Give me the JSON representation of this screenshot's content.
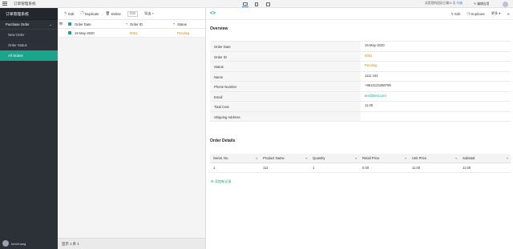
{
  "topbar": {
    "app_title": "订单管理系统",
    "trial_text": "试用您的团队已剩 6 天",
    "upgrade_label": "升级",
    "edit_app_label": "编辑应用"
  },
  "sidebar": {
    "brand": "订单管理系统",
    "group_label": "Purchase Order",
    "items": [
      {
        "label": "New Order"
      },
      {
        "label": "Order Status"
      },
      {
        "label": "All Orders"
      }
    ],
    "user_name": "kevinhang"
  },
  "list": {
    "toolbar": {
      "edit_label": "Edit",
      "duplicate_label": "Duplicate",
      "delete_label": "Delete",
      "print_label": "打印",
      "more_label": "导出"
    },
    "columns": [
      "Order Date",
      "Order ID",
      "Status"
    ],
    "rows": [
      {
        "date": "15-May-2020",
        "id": "0001",
        "status": "Pending"
      }
    ],
    "footer": "显示 1 条 1"
  },
  "detail": {
    "actions": {
      "edit_label": "Edit",
      "duplicate_label": "Duplicate",
      "more_label": "更多"
    },
    "overview_title": "Overview",
    "fields": [
      {
        "label": "Order Date",
        "value": "15-May-2020"
      },
      {
        "label": "Order ID",
        "value": "0001"
      },
      {
        "label": "Status",
        "value": "Pending"
      },
      {
        "label": "Name",
        "value": "1111 444"
      },
      {
        "label": "Phone Number",
        "value": "+8613123456789"
      },
      {
        "label": "Email",
        "value": "test@test.com"
      },
      {
        "label": "Total Cost",
        "value": "11.00"
      },
      {
        "label": "Shipping Address",
        "value": ""
      }
    ],
    "order_details_title": "Order Details",
    "grid_columns": [
      "Serial. No.",
      "Product Name",
      "Quantity",
      "Retail Price",
      "Unit Price",
      "Subtotal"
    ],
    "grid_rows": [
      {
        "serial": "1",
        "product": "111",
        "qty": "1",
        "retail": "0.00",
        "unit": "11.00",
        "subtotal": "11.00"
      }
    ],
    "add_link": "添加新记录"
  },
  "colors": {
    "accent": "#1aa68c",
    "sidebar_bg": "#2c3138",
    "link_orange": "#c98a1f"
  }
}
